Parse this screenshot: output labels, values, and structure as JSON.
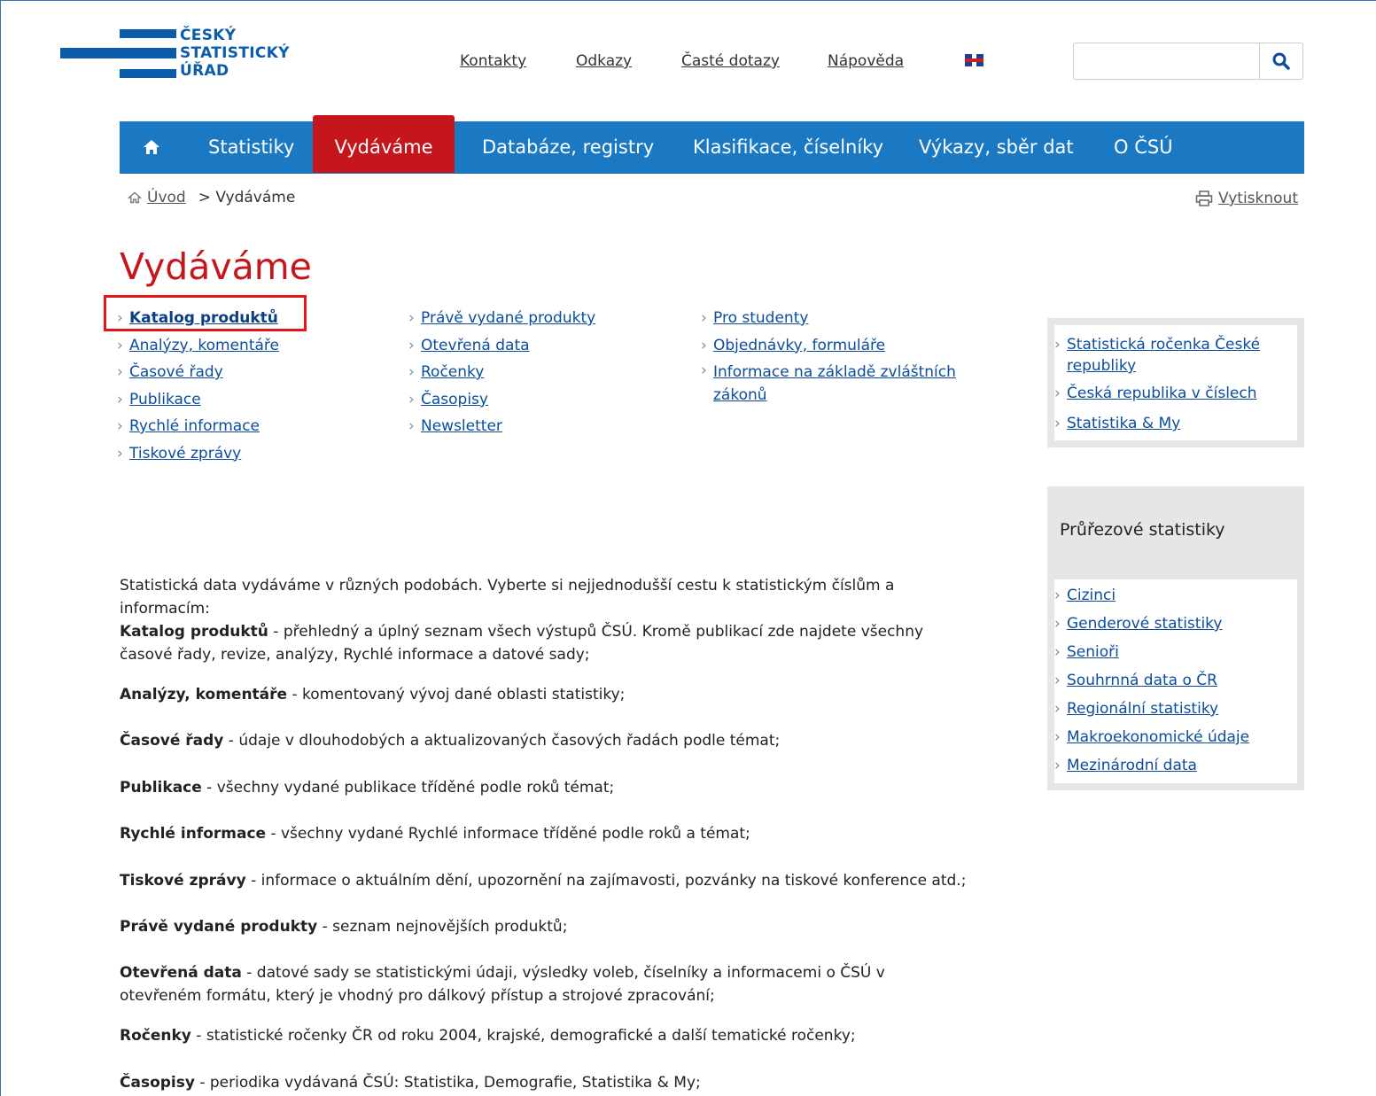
{
  "logo": {
    "line1": "ČESKÝ",
    "line2": "STATISTICKÝ",
    "line3": "ÚŘAD"
  },
  "top_links": [
    "Kontakty",
    "Odkazy",
    "Časté dotazy",
    "Nápověda"
  ],
  "search": {
    "value": "",
    "placeholder": "",
    "button_icon": "search-icon"
  },
  "language_flag": "uk-flag-icon",
  "nav": {
    "home_icon": "home-icon",
    "items": [
      "Statistiky",
      "Vydáváme",
      "Databáze, registry",
      "Klasifikace, číselníky",
      "Výkazy, sběr dat",
      "O ČSÚ"
    ],
    "active": "Vydáváme"
  },
  "breadcrumb": {
    "home": "Úvod",
    "current": "> Vydáváme"
  },
  "print_label": "Vytisknout",
  "page_title": "Vydáváme",
  "links": {
    "col1": [
      "Katalog produktů",
      "Analýzy, komentáře",
      "Časové řady",
      "Publikace",
      "Rychlé informace",
      "Tiskové zprávy"
    ],
    "col2": [
      "Právě vydané produkty",
      "Otevřená data",
      "Ročenky",
      "Časopisy",
      "Newsletter"
    ],
    "col3": [
      "Pro studenty",
      "Objednávky, formuláře",
      "Informace na základě zvláštních zákonů"
    ]
  },
  "sidebar": {
    "box1": [
      "Statistická ročenka České republiky",
      "Česká republika v číslech",
      "Statistika & My"
    ],
    "box2_title": "Průřezové statistiky",
    "box2": [
      "Cizinci",
      "Genderové statistiky",
      "Senioři",
      "Souhrnná data o ČR",
      "Regionální statistiky",
      "Makroekonomické údaje",
      "Mezinárodní data"
    ]
  },
  "intro": "Statistická data vydáváme v různých podobách. Vyberte si nejjednodušší cestu k statistickým číslům a informacím:",
  "descriptions": [
    {
      "term": "Katalog produktů",
      "text": " - přehledný a úplný seznam všech výstupů ČSÚ. Kromě publikací zde najdete všechny časové řady, revize, analýzy, Rychlé informace a datové sady;"
    },
    {
      "term": "Analýzy, komentáře",
      "text": " - komentovaný vývoj dané oblasti statistiky;"
    },
    {
      "term": "Časové řady",
      "text": " - údaje v dlouhodobých a aktualizovaných časových řadách podle témat;"
    },
    {
      "term": "Publikace",
      "text": " - všechny vydané publikace tříděné podle roků témat;"
    },
    {
      "term": "Rychlé informace",
      "text": " - všechny vydané Rychlé informace tříděné podle roků a témat;"
    },
    {
      "term": "Tiskové zprávy",
      "text": " - informace o aktuálním dění, upozornění na zajímavosti, pozvánky na tiskové konference atd.;"
    },
    {
      "term": "Právě vydané produkty",
      "text": " - seznam nejnovějších produktů;"
    },
    {
      "term": "Otevřená data",
      "text": " - datové sady se statistickými údaji, výsledky voleb, číselníky a informacemi o ČSÚ v otevřeném formátu, který je vhodný pro dálkový přístup a strojové zpracování;"
    },
    {
      "term": "Ročenky",
      "text": " - statistické ročenky ČR od roku 2004, krajské, demografické a další tematické ročenky;"
    },
    {
      "term": "Časopisy",
      "text": " - periodika vydávaná ČSÚ: Statistika, Demografie, Statistika & My;"
    }
  ]
}
